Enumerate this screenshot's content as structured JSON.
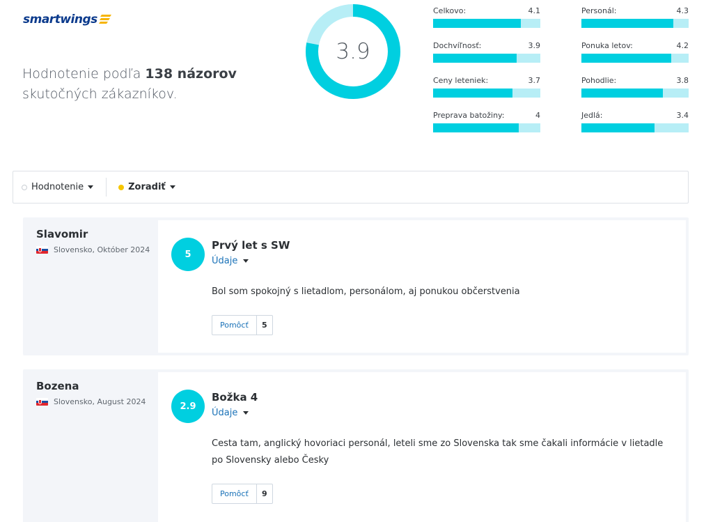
{
  "brand": {
    "name": "smartwings",
    "color": "#0b3a8c",
    "icon": "wing-logo-icon",
    "accent": "#f6b400"
  },
  "summary": {
    "prefix": "Hodnotenie podľa ",
    "count_text": "138 názorov",
    "suffix": " skutočných zákazníkov."
  },
  "overall": {
    "score": "3.9",
    "fraction": 0.78,
    "color": "#00cfe0",
    "track": "#b7eef6"
  },
  "metrics": [
    {
      "label": "Celkovo:",
      "value": "4.1",
      "fraction": 0.82
    },
    {
      "label": "Dochvíľnosť:",
      "value": "3.9",
      "fraction": 0.78
    },
    {
      "label": "Ceny leteniek:",
      "value": "3.7",
      "fraction": 0.74
    },
    {
      "label": "Preprava batožiny:",
      "value": "4",
      "fraction": 0.8
    },
    {
      "label": "Personál:",
      "value": "4.3",
      "fraction": 0.86
    },
    {
      "label": "Ponuka letov:",
      "value": "4.2",
      "fraction": 0.84
    },
    {
      "label": "Pohodlie:",
      "value": "3.8",
      "fraction": 0.76
    },
    {
      "label": "Jedlá:",
      "value": "3.4",
      "fraction": 0.68
    }
  ],
  "filters": {
    "rating_label": "Hodnotenie",
    "sort_label": "Zoradiť"
  },
  "reviews": [
    {
      "author": "Slavomir",
      "origin": "Slovensko, Október 2024",
      "score": "5",
      "title": "Prvý let s SW",
      "details_label": "Údaje",
      "text": "Bol som spokojný s lietadlom, personálom, aj ponukou občerstvenia",
      "helpful_label": "Pomôcť",
      "helpful_count": "5"
    },
    {
      "author": "Bozena",
      "origin": "Slovensko, August 2024",
      "score": "2.9",
      "title": "Božka 4",
      "details_label": "Údaje",
      "text": "Cesta tam, anglický hovoriaci personál, leteli sme zo Slovenska tak sme čakali informácie v lietadle po Slovensky alebo Česky",
      "helpful_label": "Pomôcť",
      "helpful_count": "9"
    }
  ]
}
